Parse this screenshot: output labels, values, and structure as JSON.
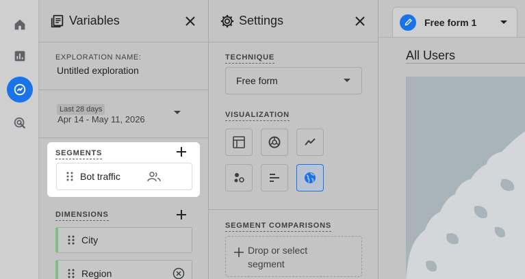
{
  "nav": {
    "items": [
      {
        "name": "home-icon"
      },
      {
        "name": "reports-icon"
      },
      {
        "name": "explore-icon",
        "active": true
      },
      {
        "name": "advertising-icon"
      }
    ]
  },
  "variables": {
    "title": "Variables",
    "exploration_name_label": "EXPLORATION NAME:",
    "exploration_name": "Untitled exploration",
    "date_chip": "Last 28 days",
    "date_range": "Apr 14 - May 11, 2026",
    "segments_label": "SEGMENTS",
    "segments": [
      {
        "label": "Bot traffic"
      }
    ],
    "dimensions_label": "DIMENSIONS",
    "dimensions": [
      {
        "label": "City"
      },
      {
        "label": "Region"
      }
    ]
  },
  "settings": {
    "title": "Settings",
    "technique_label": "TECHNIQUE",
    "technique_value": "Free form",
    "visualization_label": "VISUALIZATION",
    "visualizations": [
      {
        "name": "table-viz-icon"
      },
      {
        "name": "donut-viz-icon"
      },
      {
        "name": "line-viz-icon"
      },
      {
        "name": "scatter-viz-icon"
      },
      {
        "name": "bar-viz-icon"
      },
      {
        "name": "geo-map-viz-icon",
        "selected": true
      }
    ],
    "segment_comparisons_label": "SEGMENT COMPARISONS",
    "drop_segment": "Drop or select segment"
  },
  "canvas": {
    "tab_label": "Free form 1",
    "segment_title": "All Users"
  },
  "colors": {
    "accent": "#1a73e8",
    "dimension_bar": "#7fbf7f",
    "overlay": "#c4c4c4"
  }
}
